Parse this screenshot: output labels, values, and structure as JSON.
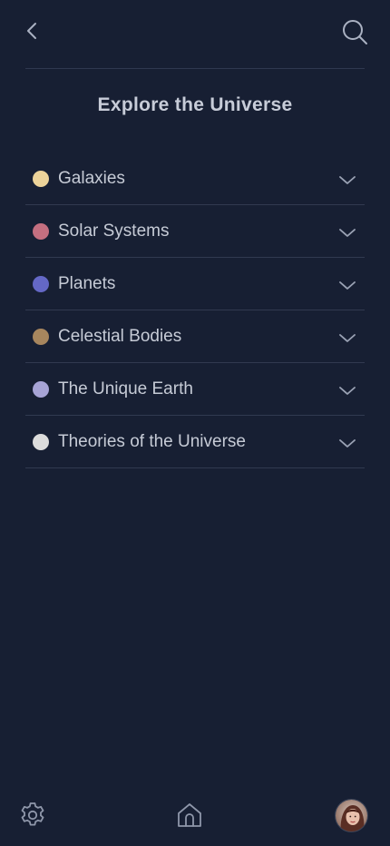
{
  "header": {
    "back_icon": "chevron-left-icon",
    "search_icon": "search-icon"
  },
  "title": "Explore the Universe",
  "categories": [
    {
      "label": "Galaxies",
      "color": "#ecd39a"
    },
    {
      "label": "Solar Systems",
      "color": "#c46f80"
    },
    {
      "label": "Planets",
      "color": "#6468c6"
    },
    {
      "label": "Celestial Bodies",
      "color": "#a7865e"
    },
    {
      "label": "The Unique Earth",
      "color": "#a7a4d6"
    },
    {
      "label": "Theories of the Universe",
      "color": "#dcdcdc"
    }
  ],
  "footer": {
    "settings_icon": "gear-icon",
    "home_icon": "home-icon",
    "avatar": "user-avatar"
  },
  "colors": {
    "background": "#171f33",
    "divider": "#313a50",
    "text": "#c6cbd6",
    "icon": "#aab1c2"
  }
}
